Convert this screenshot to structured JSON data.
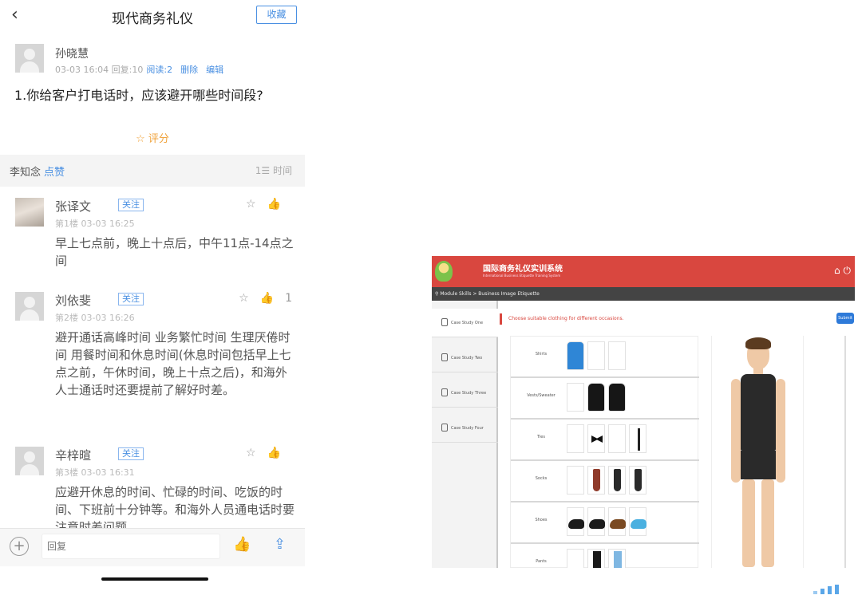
{
  "phone": {
    "title": "现代商务礼仪",
    "favorite_label": "收藏",
    "post": {
      "author": "孙晓慧",
      "meta": "03-03 16:04 回复:10",
      "read": "阅读:2",
      "delete": "删除",
      "edit": "编辑",
      "question": "1.你给客户打电话时，应该避开哪些时间段?",
      "rate_label": "评分"
    },
    "likes_row": {
      "user": "李知念",
      "action": "点赞",
      "sort": "时间"
    },
    "replies": [
      {
        "name": "张译文",
        "follow": "关注",
        "meta": "第1楼 03-03 16:25",
        "likes": "",
        "body": "早上七点前，晚上十点后，中午11点-14点之间"
      },
      {
        "name": "刘依斐",
        "follow": "关注",
        "meta": "第2楼 03-03 16:26",
        "likes": "1",
        "body": "避开通话高峰时间 业务繁忙时间 生理厌倦时间 用餐时间和休息时间(休息时间包括早上七点之前，午休时间，晚上十点之后)，和海外人士通话时还要提前了解好时差。"
      },
      {
        "name": "辛梓暄",
        "follow": "关注",
        "meta": "第3楼 03-03 16:31",
        "likes": "",
        "body": "应避开休息的时间、忙碌的时间、吃饭的时间、下班前十分钟等。和海外人员通电话时要注意时差问题"
      }
    ],
    "reply_placeholder": "回复",
    "icons": {
      "back": "chevron-left-icon",
      "rate": "star-icon",
      "like": "thumbs-up-icon",
      "share": "share-icon",
      "add": "plus-icon"
    }
  },
  "tablet": {
    "title": "国际商务礼仪实训系统",
    "subtitle": "International Business Etiquette Training System",
    "breadcrumb": "Module Skills > Business Image Etiquette",
    "tabs": [
      "Case Study One",
      "Case Study Two",
      "Case Study Three",
      "Case Study Four"
    ],
    "instruction": "Choose suitable clothing for different occasions.",
    "submit": "Submit",
    "rows": [
      "Shirts",
      "Vests/Sweater",
      "Ties",
      "Socks",
      "Shoes",
      "Pants"
    ],
    "colors": {
      "header": "#d9473f",
      "accent": "#2e7ad9"
    }
  }
}
